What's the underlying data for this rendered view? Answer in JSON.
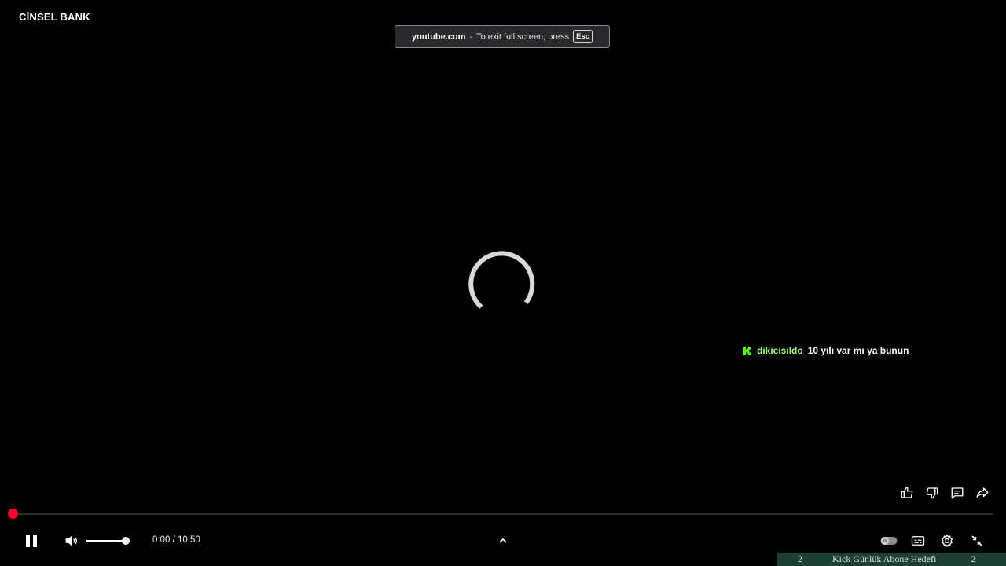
{
  "channel": {
    "title": "CİNSEL BANK"
  },
  "fullscreen_notice": {
    "domain": "youtube.com",
    "separator": "-",
    "message": "To exit full screen, press",
    "key": "Esc"
  },
  "chat_overlay": {
    "username": "dikicisildo",
    "message": "10 yılı var mı ya bunun",
    "platform_icon": "kick-icon",
    "username_color": "#a6ff7a"
  },
  "side_actions": [
    {
      "name": "like-icon"
    },
    {
      "name": "dislike-icon"
    },
    {
      "name": "comment-icon"
    },
    {
      "name": "share-icon"
    }
  ],
  "player": {
    "state": "buffering",
    "progress_fraction": 0.0,
    "volume_fraction": 1.0,
    "current_time": "0:00",
    "duration": "10:50",
    "time_display": "0:00 / 10:50",
    "accent_color": "#ff0033",
    "controls": {
      "play_pause_icon": "pause-icon",
      "volume_icon": "volume-icon",
      "chevron_icon": "chevron-up-icon",
      "autoplay_icon": "autoplay-toggle-icon",
      "subtitles_icon": "subtitles-icon",
      "settings_icon": "settings-icon",
      "exit_fullscreen_icon": "exit-fullscreen-icon"
    }
  },
  "ticker": {
    "count_left": "2",
    "label": "Kick Günlük Abone Hedefi",
    "count_right": "2",
    "background_color": "#1d4034"
  }
}
